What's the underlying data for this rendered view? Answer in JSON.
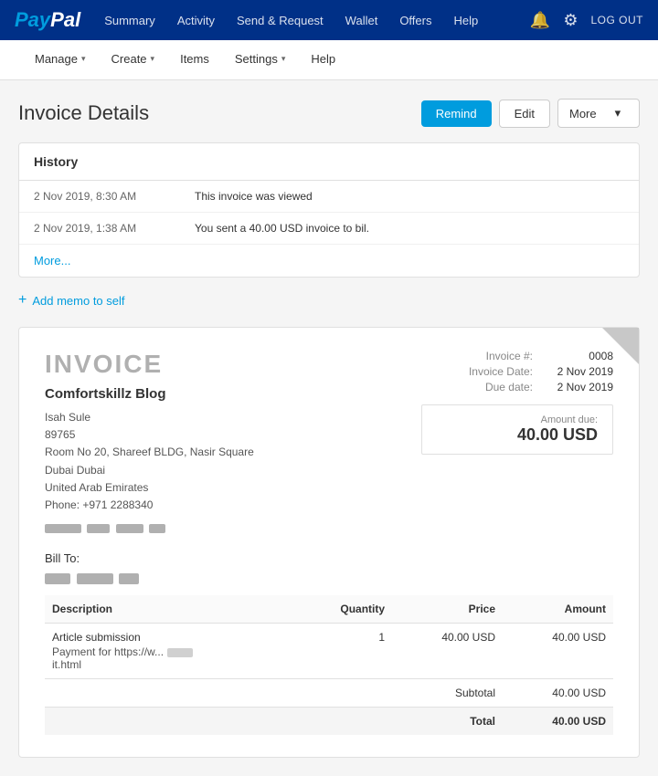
{
  "topNav": {
    "logo": "PayPal",
    "links": [
      "Summary",
      "Activity",
      "Send & Request",
      "Wallet",
      "Offers",
      "Help"
    ],
    "icons": {
      "notification": "🔔",
      "settings": "⚙"
    },
    "logout": "LOG OUT"
  },
  "subNav": {
    "items": [
      {
        "label": "Manage",
        "hasDropdown": true
      },
      {
        "label": "Create",
        "hasDropdown": true
      },
      {
        "label": "Items",
        "hasDropdown": false
      },
      {
        "label": "Settings",
        "hasDropdown": true
      },
      {
        "label": "Help",
        "hasDropdown": false
      }
    ]
  },
  "pageTitle": "Invoice Details",
  "actions": {
    "remind": "Remind",
    "edit": "Edit",
    "more": "More"
  },
  "history": {
    "title": "History",
    "rows": [
      {
        "date": "2 Nov 2019, 8:30 AM",
        "text": "This invoice was viewed"
      },
      {
        "date": "2 Nov 2019, 1:38 AM",
        "text": "You sent a 40.00 USD invoice to bil."
      }
    ],
    "moreLink": "More..."
  },
  "addMemo": "Add memo to self",
  "invoice": {
    "title": "INVOICE",
    "companyName": "Comfortskillz Blog",
    "address": {
      "name": "Isah Sule",
      "line1": "89765",
      "line2": "Room No 20, Shareef BLDG, Nasir Square",
      "line3": "Dubai Dubai",
      "line4": "United Arab Emirates",
      "phone": "Phone: +971 2288340"
    },
    "meta": {
      "invoiceNumLabel": "Invoice #:",
      "invoiceNum": "0008",
      "invoiceDateLabel": "Invoice Date:",
      "invoiceDate": "2 Nov 2019",
      "dueDateLabel": "Due date:",
      "dueDate": "2 Nov 2019"
    },
    "amountDue": {
      "label": "Amount due:",
      "value": "40.00 USD"
    },
    "billTo": "Bill To:",
    "table": {
      "headers": [
        "Description",
        "Quantity",
        "Price",
        "Amount"
      ],
      "rows": [
        {
          "description": "Article submission",
          "descriptionLine2": "Payment for https://w...",
          "descriptionLine3": "it.html",
          "quantity": "1",
          "price": "40.00 USD",
          "amount": "40.00 USD"
        }
      ],
      "subtotalLabel": "Subtotal",
      "subtotalValue": "40.00 USD",
      "totalLabel": "Total",
      "totalValue": "40.00 USD"
    }
  }
}
